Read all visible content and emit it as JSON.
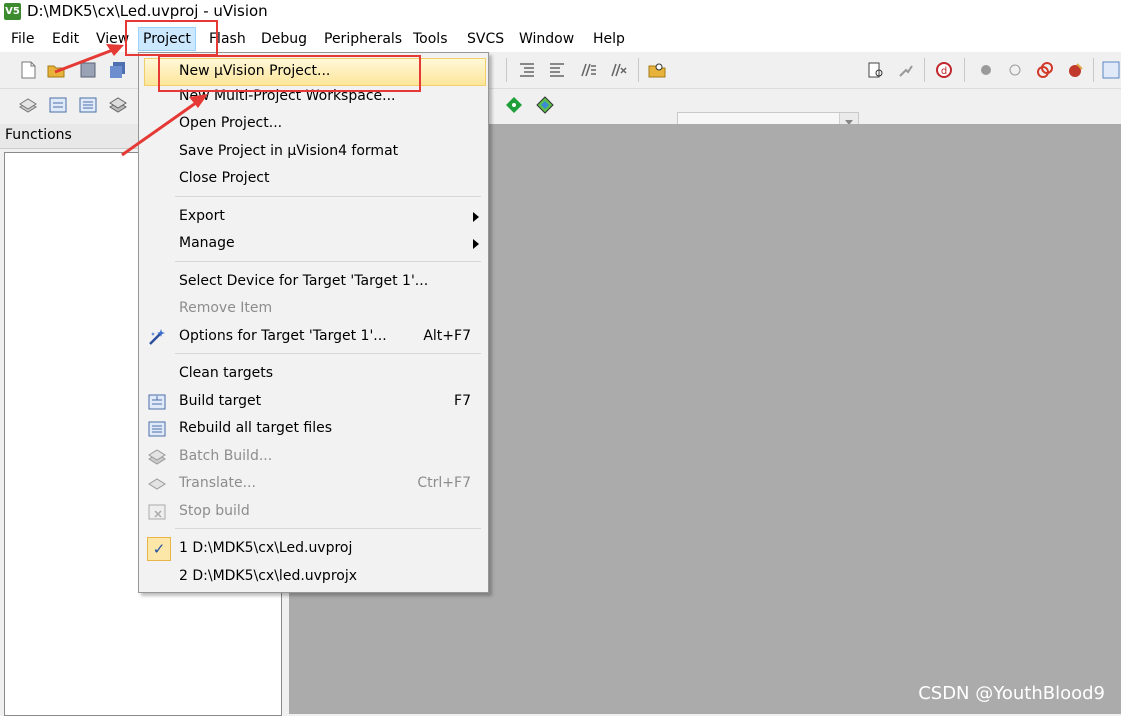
{
  "window": {
    "title": "D:\\MDK5\\cx\\Led.uvproj - uVision",
    "logo": "V5"
  },
  "menubar": [
    {
      "label": "File"
    },
    {
      "label": "Edit"
    },
    {
      "label": "View"
    },
    {
      "label": "Project"
    },
    {
      "label": "Flash"
    },
    {
      "label": "Debug"
    },
    {
      "label": "Peripherals"
    },
    {
      "label": "Tools"
    },
    {
      "label": "SVCS"
    },
    {
      "label": "Window"
    },
    {
      "label": "Help"
    }
  ],
  "active_menu": "Project",
  "panels": {
    "functions_title": "Functions"
  },
  "project_menu": {
    "items": [
      {
        "label": "New µVision Project...",
        "state": "highlighted"
      },
      {
        "label": "New Multi-Project Workspace..."
      },
      {
        "label": "Open Project..."
      },
      {
        "label": "Save Project in µVision4 format"
      },
      {
        "label": "Close Project"
      },
      {
        "label": "Export",
        "submenu": true
      },
      {
        "label": "Manage",
        "submenu": true
      },
      {
        "label": "Select Device for Target 'Target 1'..."
      },
      {
        "label": "Remove Item",
        "disabled": true
      },
      {
        "label": "Options for Target 'Target 1'...",
        "shortcut": "Alt+F7",
        "icon": "magic-wand-icon"
      },
      {
        "label": "Clean targets"
      },
      {
        "label": "Build target",
        "shortcut": "F7",
        "icon": "build-icon"
      },
      {
        "label": "Rebuild all target files",
        "icon": "rebuild-icon"
      },
      {
        "label": "Batch Build...",
        "disabled": true,
        "icon": "batch-build-icon"
      },
      {
        "label": "Translate...",
        "shortcut": "Ctrl+F7",
        "disabled": true,
        "icon": "translate-icon"
      },
      {
        "label": "Stop build",
        "disabled": true,
        "icon": "stop-build-icon"
      },
      {
        "label": "1 D:\\MDK5\\cx\\Led.uvproj",
        "checked": true
      },
      {
        "label": "2 D:\\MDK5\\cx\\led.uvprojx"
      }
    ]
  },
  "watermark": "CSDN @YouthBlood9",
  "colors": {
    "annotation_red": "#e53935",
    "editor_bg": "#ababab",
    "highlight": "#fde59a"
  }
}
